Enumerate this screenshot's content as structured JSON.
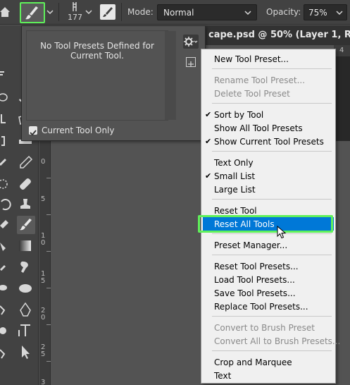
{
  "options_bar": {
    "brush_size": "177",
    "mode_label": "Mode:",
    "mode_value": "Normal",
    "opacity_label": "Opacity:",
    "opacity_value": "75%"
  },
  "document_tab": {
    "title": "cape.psd @ 50% (Layer 1, RGB/8#"
  },
  "ruler": {
    "top_tick": "4",
    "left_marks": [
      "0",
      "5",
      "1\n0",
      "1\n5",
      "2\n0",
      "2\n5",
      "3"
    ]
  },
  "tool_presets": {
    "empty_message": "No Tool Presets Defined for Current Tool.",
    "current_tool_only_label": "Current Tool Only",
    "current_tool_only_checked": true
  },
  "menu": {
    "groups": [
      [
        {
          "label": "New Tool Preset...",
          "enabled": true
        }
      ],
      [
        {
          "label": "Rename Tool Preset...",
          "enabled": false
        },
        {
          "label": "Delete Tool Preset",
          "enabled": false
        }
      ],
      [
        {
          "label": "Sort by Tool",
          "enabled": true,
          "checked": true
        },
        {
          "label": "Show All Tool Presets",
          "enabled": true
        },
        {
          "label": "Show Current Tool Presets",
          "enabled": true,
          "checked": true
        }
      ],
      [
        {
          "label": "Text Only",
          "enabled": true
        },
        {
          "label": "Small List",
          "enabled": true,
          "checked": true
        },
        {
          "label": "Large List",
          "enabled": true
        }
      ],
      [
        {
          "label": "Reset Tool",
          "enabled": true
        },
        {
          "label": "Reset All Tools",
          "enabled": true,
          "highlighted": true
        }
      ],
      [
        {
          "label": "Preset Manager...",
          "enabled": true
        }
      ],
      [
        {
          "label": "Reset Tool Presets...",
          "enabled": true
        },
        {
          "label": "Load Tool Presets...",
          "enabled": true
        },
        {
          "label": "Save Tool Presets...",
          "enabled": true
        },
        {
          "label": "Replace Tool Presets...",
          "enabled": true
        }
      ],
      [
        {
          "label": "Convert to Brush Preset",
          "enabled": false
        },
        {
          "label": "Convert All to Brush Presets...",
          "enabled": false
        }
      ],
      [
        {
          "label": "Crop and Marquee",
          "enabled": true
        },
        {
          "label": "Text",
          "enabled": true
        }
      ]
    ]
  },
  "colors": {
    "highlight": "#0078d7",
    "annotation_outline": "#5ff05a",
    "panel_bg": "#535353",
    "bar_bg": "#424242"
  }
}
